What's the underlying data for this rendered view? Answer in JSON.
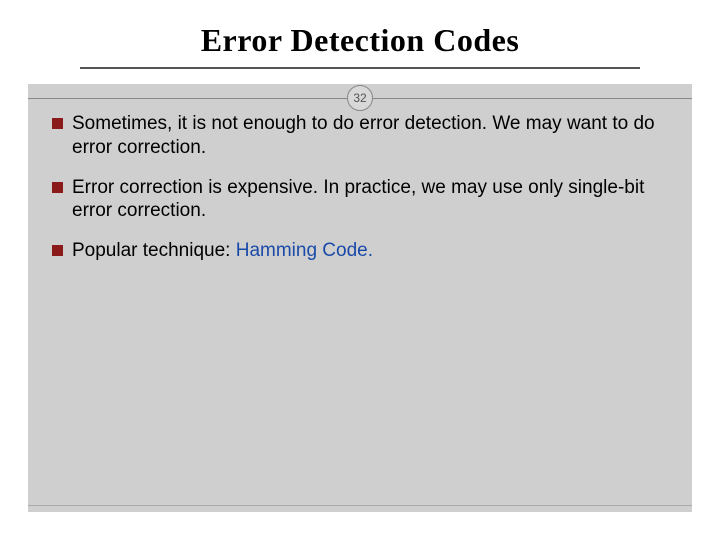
{
  "slide": {
    "title": "Error Detection Codes",
    "number": "32",
    "bullets": [
      {
        "text": "Sometimes, it is not enough to do error detection.  We may want to do error correction."
      },
      {
        "text": "Error correction is expensive.  In practice, we may use only single-bit error correction."
      },
      {
        "prefix": "Popular technique: ",
        "link": "Hamming Code."
      }
    ]
  }
}
